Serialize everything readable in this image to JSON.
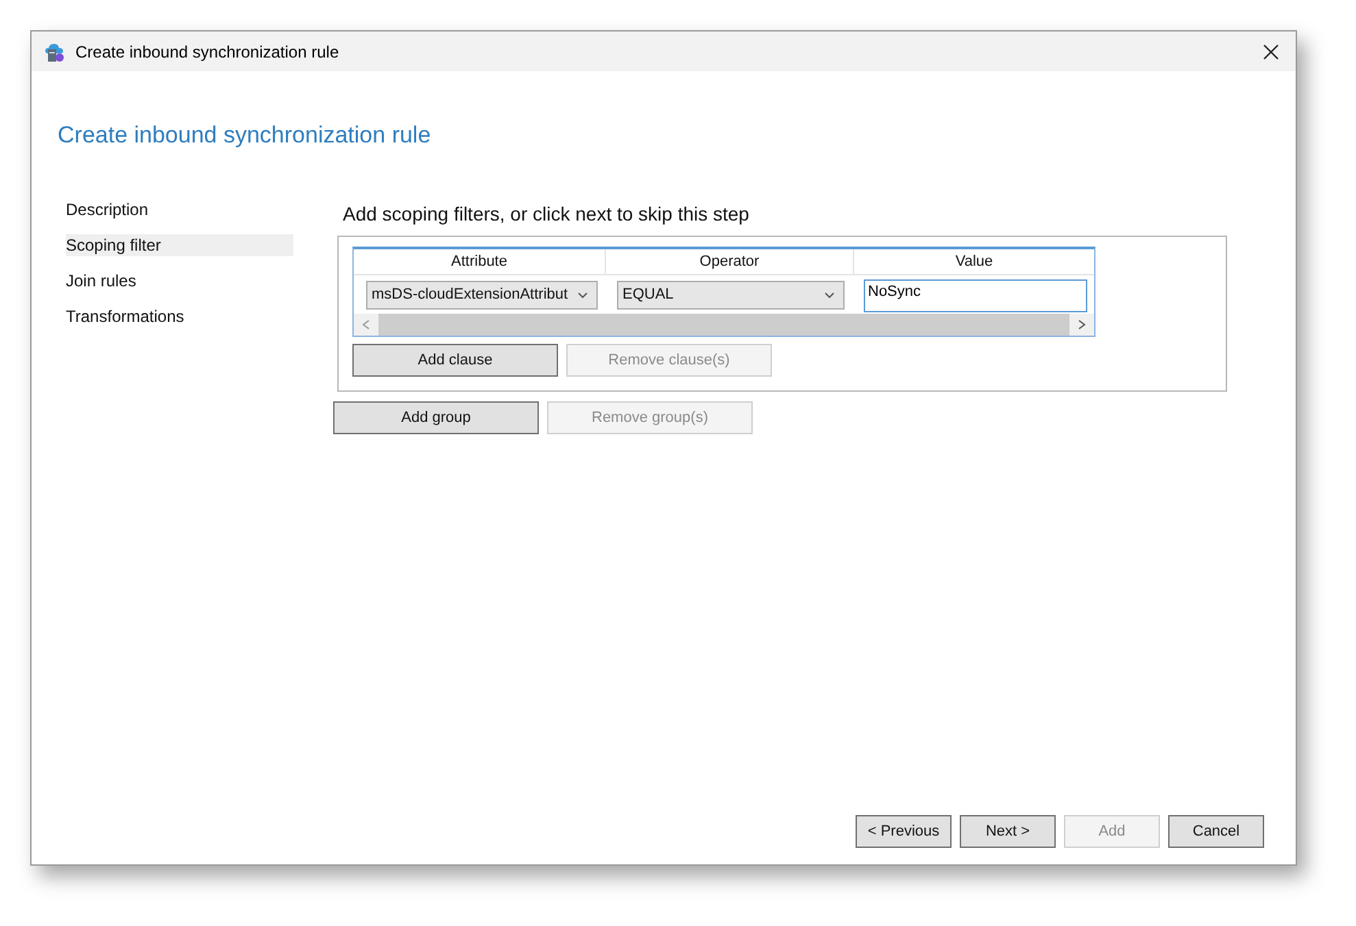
{
  "window": {
    "title": "Create inbound synchronization rule"
  },
  "heading": "Create inbound synchronization rule",
  "steps": [
    {
      "label": "Description",
      "selected": false
    },
    {
      "label": "Scoping filter",
      "selected": true
    },
    {
      "label": "Join rules",
      "selected": false
    },
    {
      "label": "Transformations",
      "selected": false
    }
  ],
  "section_title": "Add scoping filters, or click next to skip this step",
  "filter_table": {
    "columns": [
      "Attribute",
      "Operator",
      "Value"
    ],
    "rows": [
      {
        "attribute": "msDS-cloudExtensionAttribut",
        "operator": "EQUAL",
        "value": "NoSync"
      }
    ]
  },
  "clause_buttons": [
    {
      "label": "Add clause",
      "disabled": false
    },
    {
      "label": "Remove clause(s)",
      "disabled": true
    }
  ],
  "group_buttons": [
    {
      "label": "Add group",
      "disabled": false
    },
    {
      "label": "Remove group(s)",
      "disabled": true
    }
  ],
  "footer_buttons": [
    {
      "label": "< Previous",
      "disabled": false
    },
    {
      "label": "Next >",
      "disabled": false
    },
    {
      "label": "Add",
      "disabled": true
    },
    {
      "label": "Cancel",
      "disabled": false
    }
  ]
}
